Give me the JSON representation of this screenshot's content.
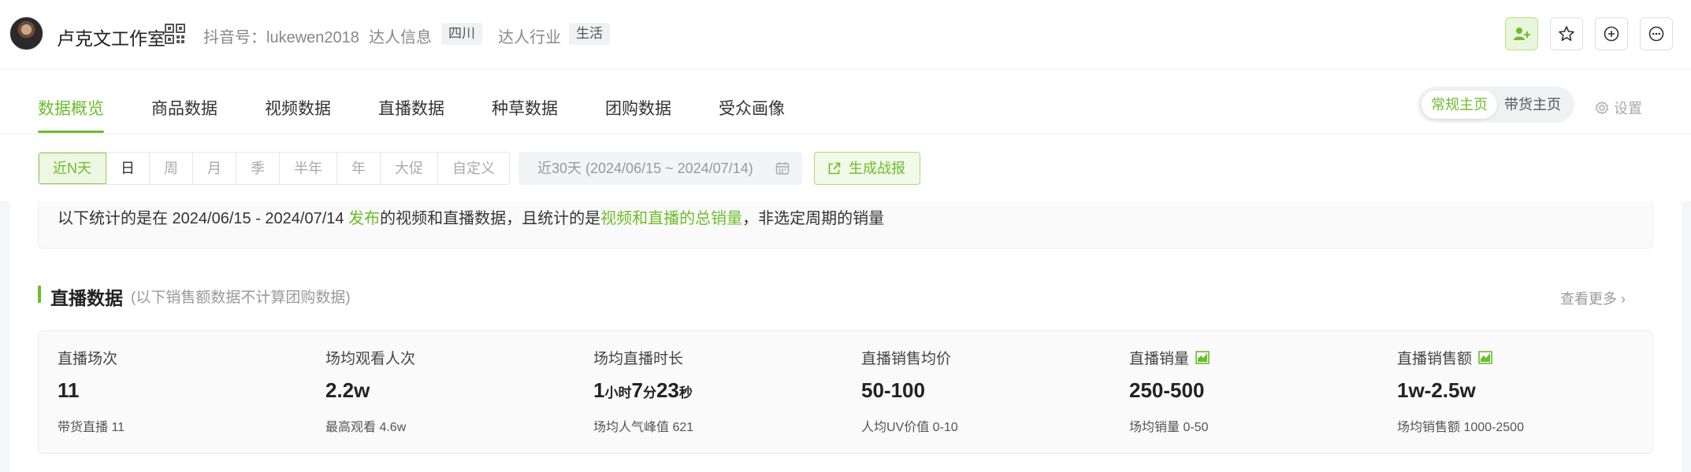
{
  "header": {
    "name": "卢克文工作室",
    "douyin_label": "抖音号：lukewen2018",
    "info_label": "达人信息",
    "info_tag": "四川",
    "industry_label": "达人行业",
    "industry_tag": "生活"
  },
  "tabs": [
    {
      "label": "数据概览",
      "active": true
    },
    {
      "label": "商品数据"
    },
    {
      "label": "视频数据"
    },
    {
      "label": "直播数据"
    },
    {
      "label": "种草数据"
    },
    {
      "label": "团购数据"
    },
    {
      "label": "受众画像"
    }
  ],
  "home_switch": {
    "regular": "常规主页",
    "goods": "带货主页"
  },
  "settings_label": "设置",
  "periods": [
    "近N天",
    "日",
    "周",
    "月",
    "季",
    "半年",
    "年",
    "大促",
    "自定义"
  ],
  "date_range": "近30天 (2024/06/15 ~ 2024/07/14)",
  "report_button": "生成战报",
  "notice": {
    "p1": "以下统计的是在 2024/06/15 - 2024/07/14 ",
    "h1": "发布",
    "p2": "的视频和直播数据，且统计的是",
    "h2": "视频和直播的总销量",
    "p3": "，非选定周期的销量"
  },
  "section": {
    "title": "直播数据",
    "subtitle": "(以下销售额数据不计算团购数据)",
    "more": "查看更多 ›"
  },
  "metrics": [
    {
      "label": "直播场次",
      "value": "11",
      "sub": "带货直播 11"
    },
    {
      "label": "场均观看人次",
      "value": "2.2w",
      "sub": "最高观看 4.6w"
    },
    {
      "label": "场均直播时长",
      "v1": "1",
      "u1": "小时",
      "v2": "7",
      "u2": "分",
      "v3": "23",
      "u3": "秒",
      "sub": "场均人气峰值 621"
    },
    {
      "label": "直播销售均价",
      "value": "50-100",
      "sub": "人均UV价值 0-10"
    },
    {
      "label": "直播销量",
      "value": "250-500",
      "sub": "场均销量 0-50",
      "has_chart_icon": true
    },
    {
      "label": "直播销售额",
      "value": "1w-2.5w",
      "sub": "场均销售额 1000-2500",
      "has_chart_icon": true
    }
  ],
  "colors": {
    "accent": "#6cbd2b"
  }
}
